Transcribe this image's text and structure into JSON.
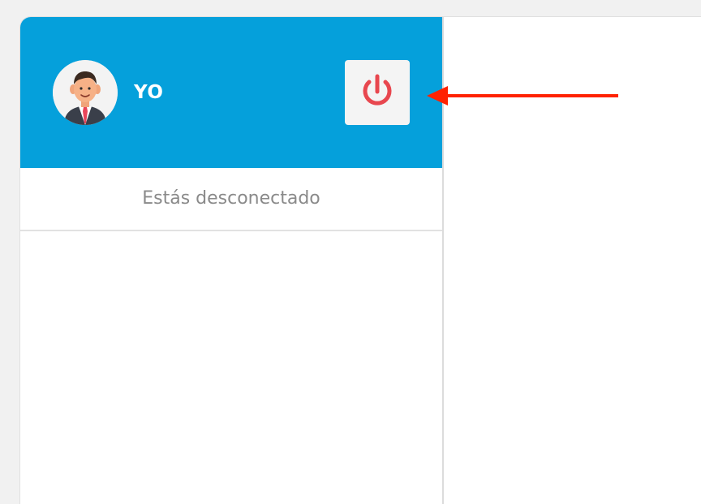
{
  "user": {
    "name": "YO",
    "avatar_icon": "man-in-suit-avatar"
  },
  "header": {
    "background_color": "#05a0db",
    "power_button_icon": "power-icon",
    "power_icon_color": "#e8474f"
  },
  "status": {
    "text": "Estás desconectado"
  },
  "annotation": {
    "arrow_color": "#ff2200",
    "target": "power-button"
  }
}
